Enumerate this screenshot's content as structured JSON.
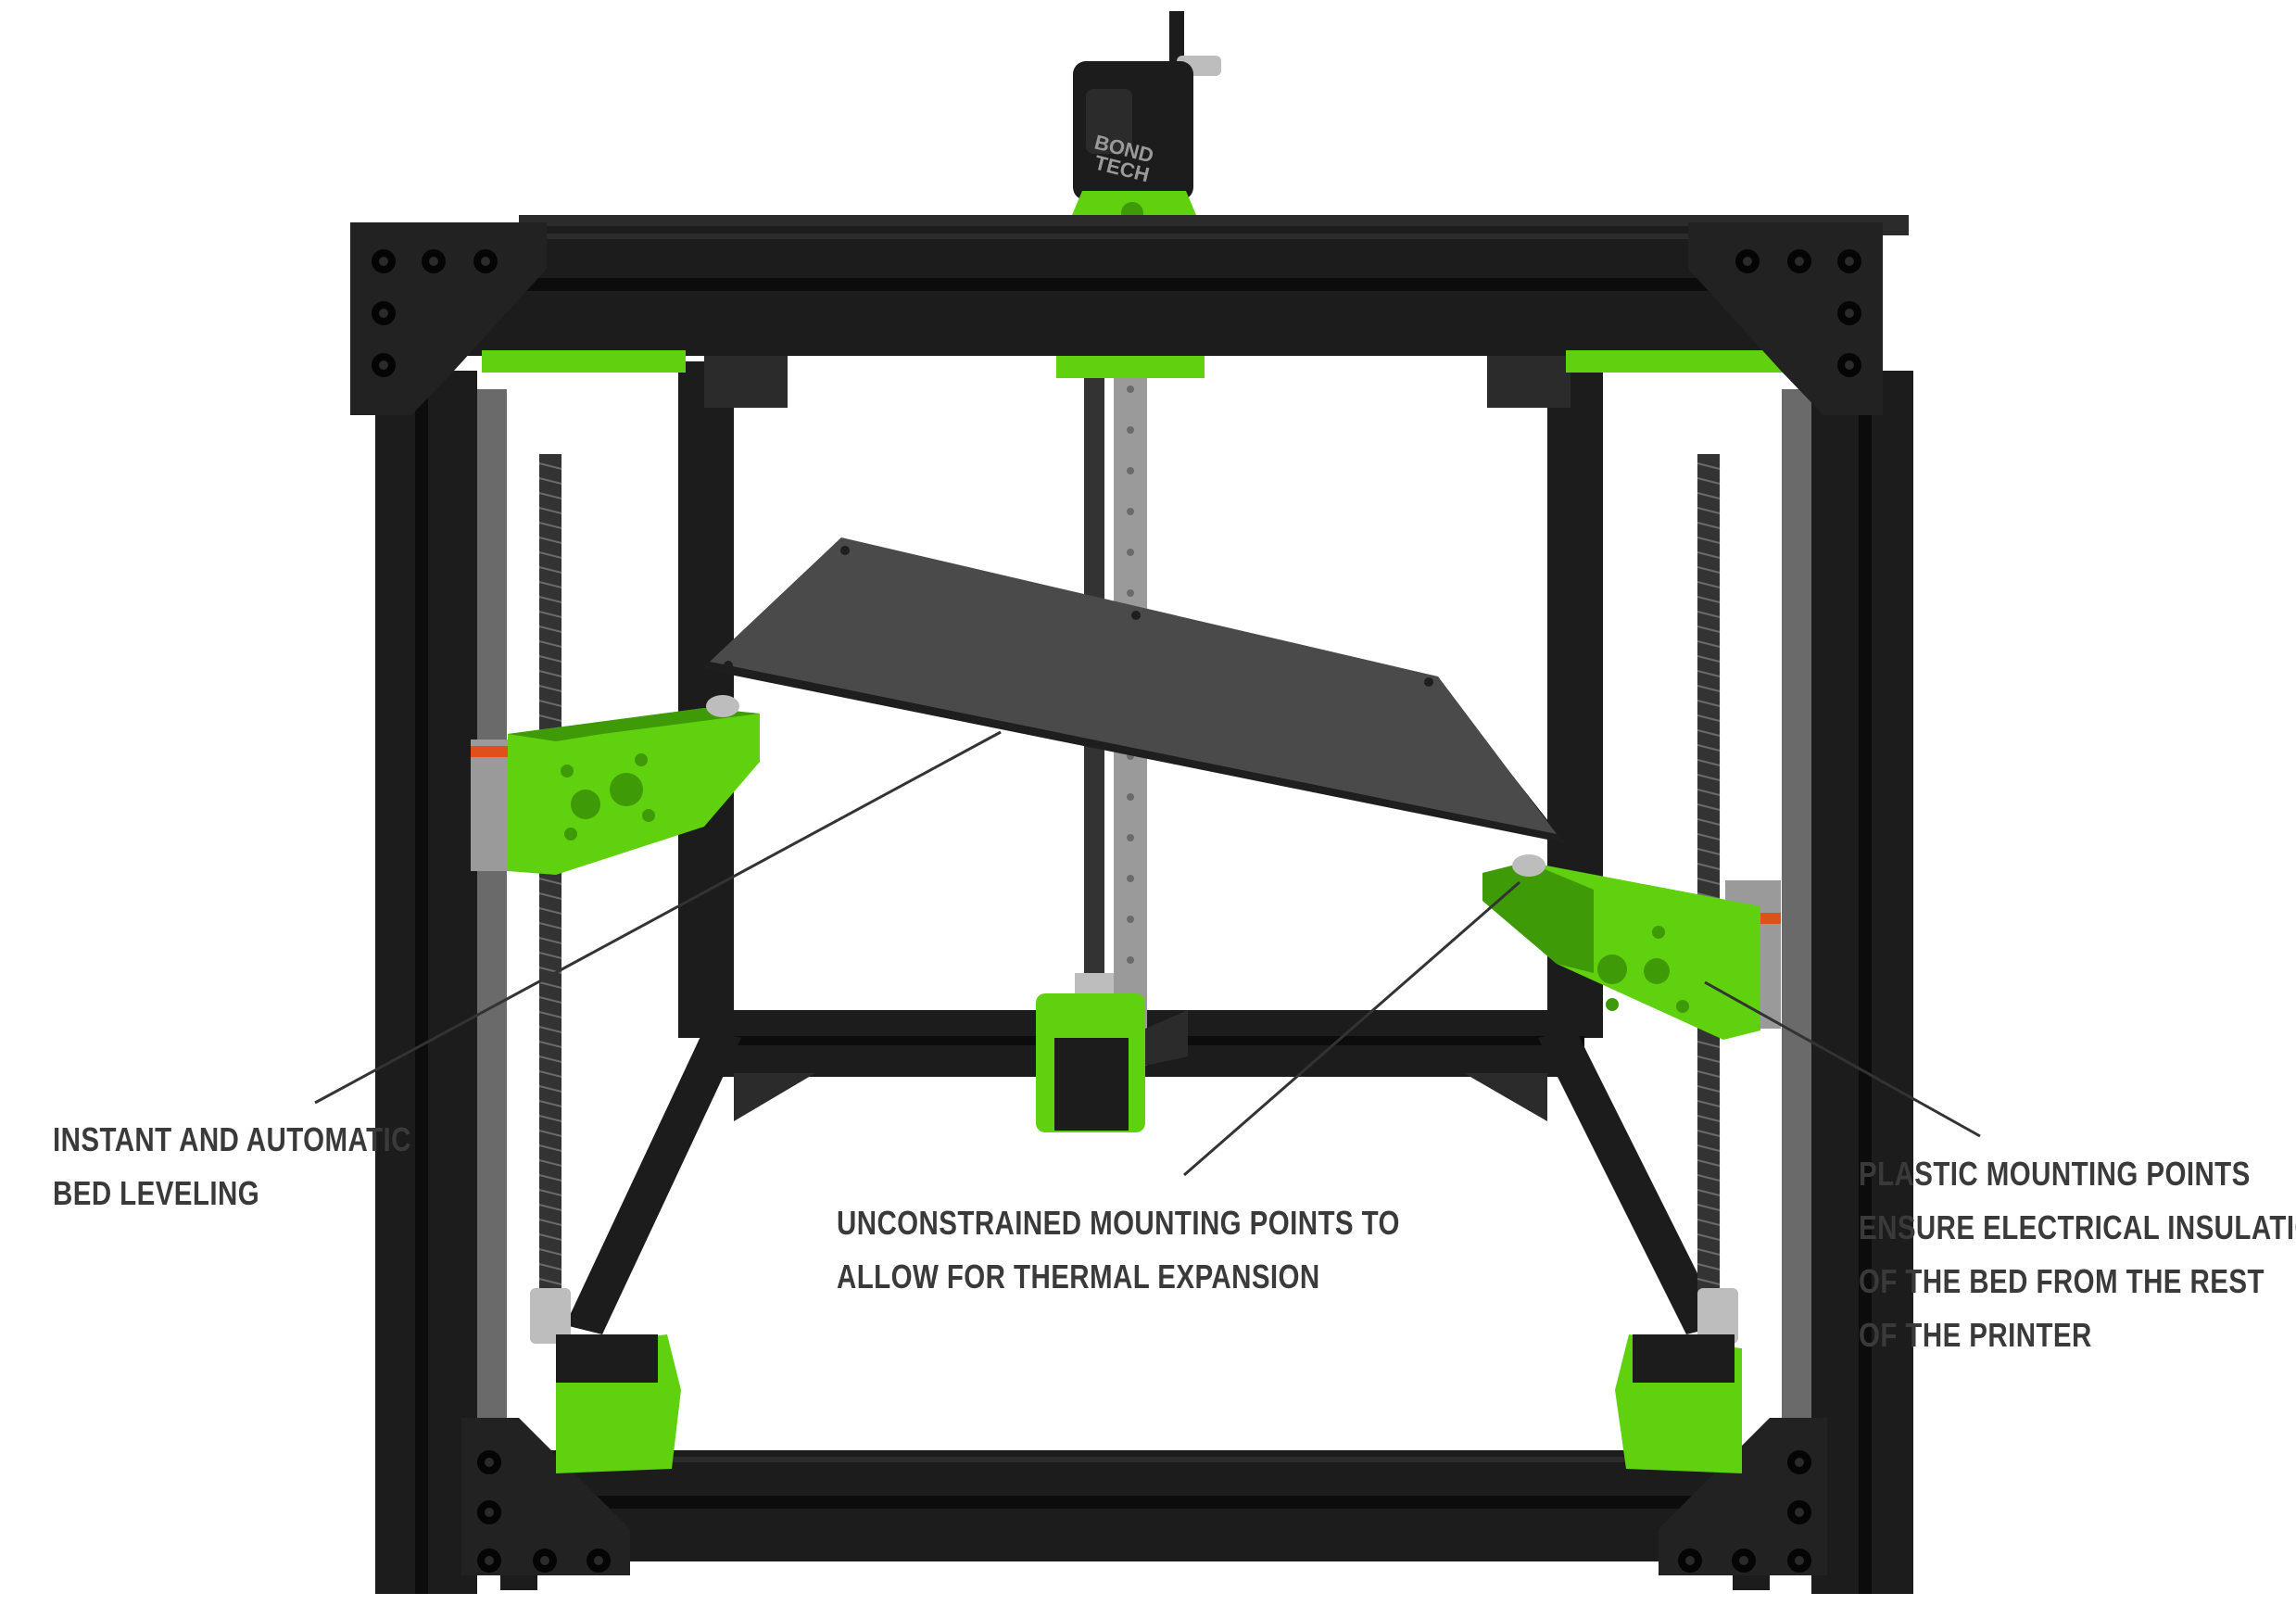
{
  "colors": {
    "frame": "#1c1c1c",
    "frame_shade": "#2b2b2b",
    "frame_slot": "#0c0c0c",
    "plate": "#222222",
    "bolt": "#050505",
    "printed_part": "#5fd10f",
    "printed_part_dark": "#3f9a08",
    "rail": "#9a9a9a",
    "rail_dark": "#6a6a6a",
    "bed": "#4a4a4a",
    "bed_edge": "#1e1e1e",
    "leadscrew": "#333333",
    "coupler": "#bdbdbd",
    "orange_accent": "#e0501a",
    "leader_line": "#333333",
    "label_text": "#3a3a3a"
  },
  "icons": {
    "extruder": "bondtech-extruder-icon",
    "bed": "build-plate-icon"
  },
  "extruder_logo": {
    "line1": "BOND",
    "line2": "TECH"
  },
  "callouts": {
    "left": {
      "lines": [
        "INSTANT AND AUTOMATIC",
        "BED LEVELING"
      ]
    },
    "middle": {
      "lines": [
        "UNCONSTRAINED MOUNTING POINTS TO",
        "ALLOW FOR THERMAL EXPANSION"
      ]
    },
    "right": {
      "lines": [
        "PLASTIC MOUNTING POINTS",
        "ENSURE ELECTRICAL INSULATION",
        "OF THE BED FROM THE REST",
        "OF THE PRINTER"
      ]
    }
  }
}
